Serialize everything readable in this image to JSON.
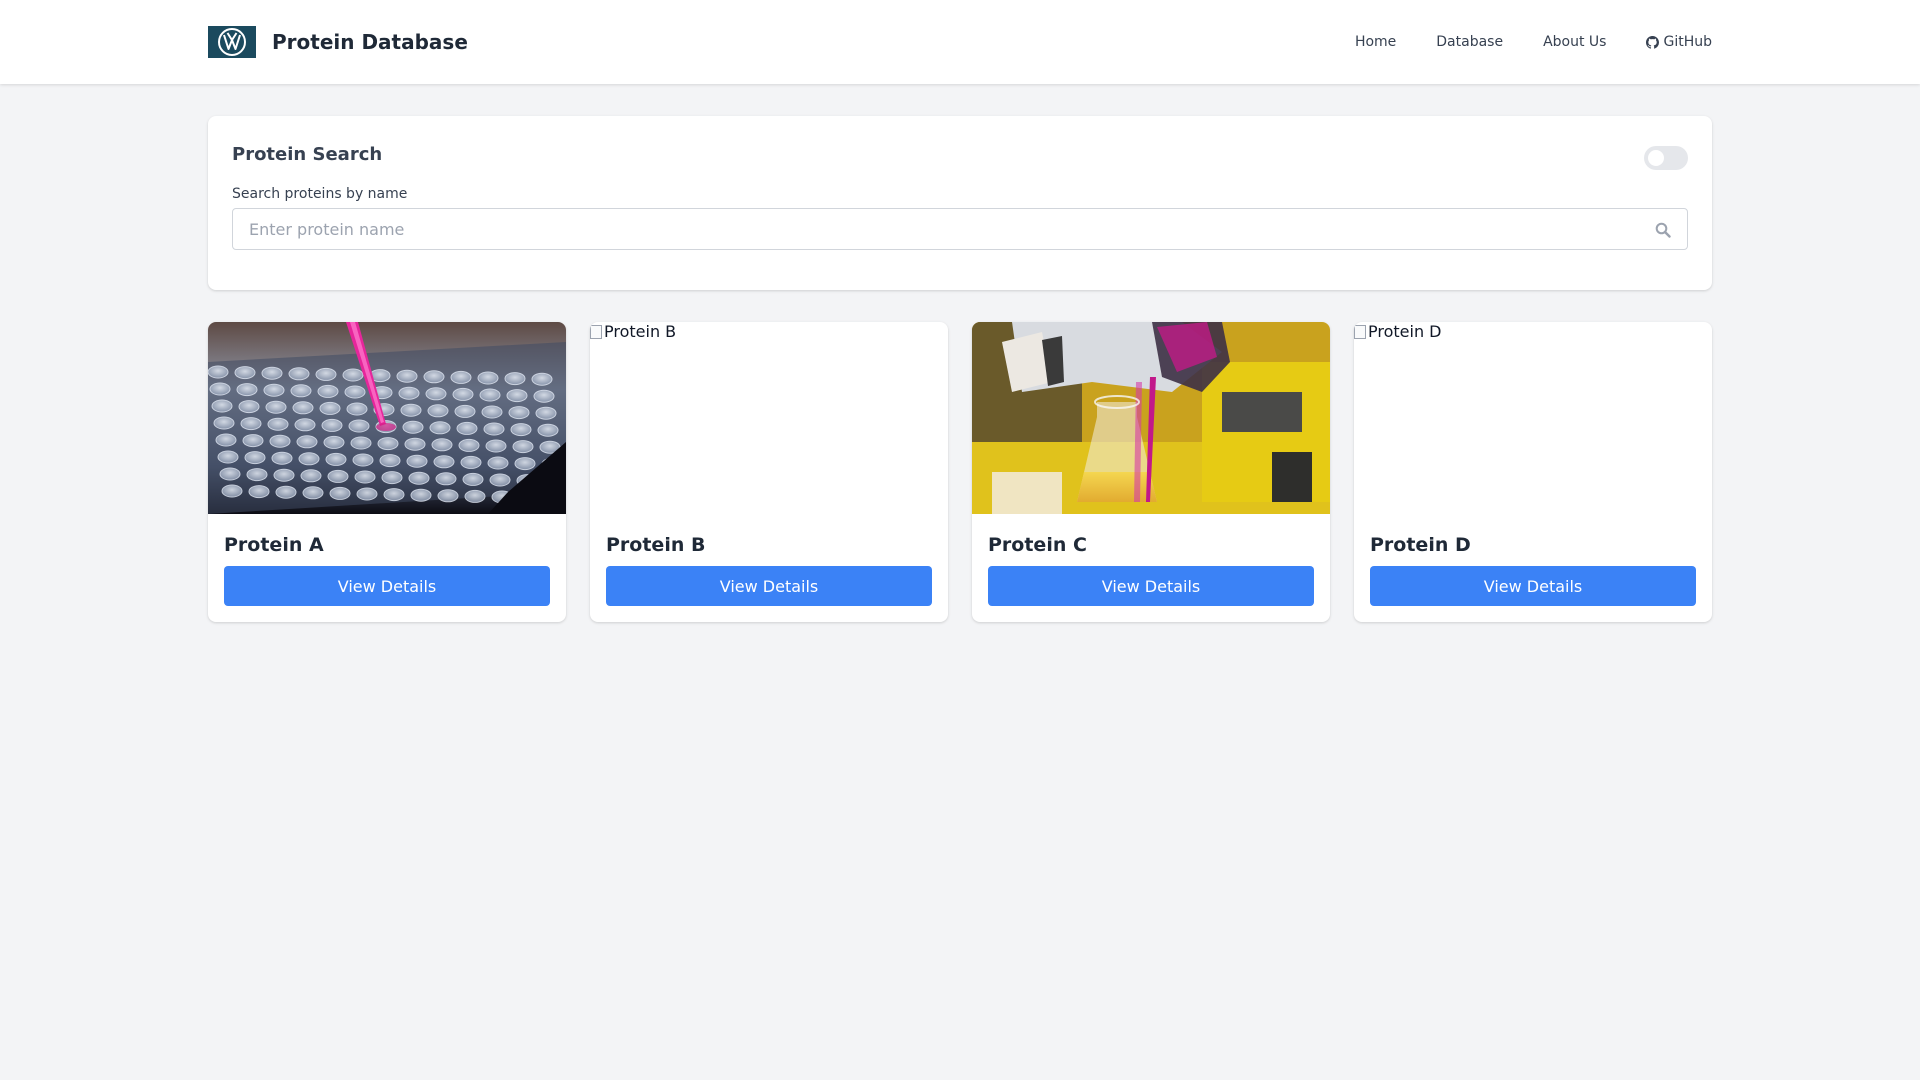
{
  "header": {
    "logo_icon": "vw-logo-icon",
    "title": "Protein Database",
    "nav": [
      {
        "label": "Home"
      },
      {
        "label": "Database"
      },
      {
        "label": "About Us"
      },
      {
        "label": "GitHub",
        "icon": "github-icon"
      }
    ]
  },
  "search": {
    "title": "Protein Search",
    "toggle_state": "off",
    "label": "Search proteins by name",
    "placeholder": "Enter protein name",
    "value": "",
    "icon": "search-icon"
  },
  "cards": [
    {
      "title": "Protein A",
      "image": "loaded",
      "image_alt": "Protein A",
      "button": "View Details"
    },
    {
      "title": "Protein B",
      "image": "broken",
      "image_alt": "Protein B",
      "button": "View Details"
    },
    {
      "title": "Protein C",
      "image": "loaded",
      "image_alt": "Protein C",
      "button": "View Details"
    },
    {
      "title": "Protein D",
      "image": "broken",
      "image_alt": "Protein D",
      "button": "View Details"
    }
  ],
  "colors": {
    "background": "#f3f4f6",
    "surface": "#ffffff",
    "accent": "#3b82f6",
    "text": "#1f2937",
    "logo_bg": "#1b4a5e"
  }
}
